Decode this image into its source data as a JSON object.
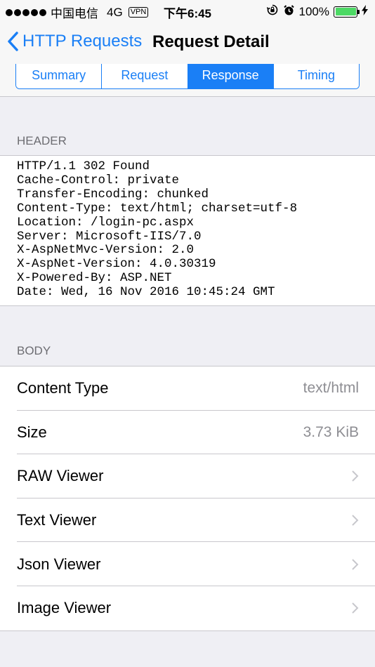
{
  "status_bar": {
    "carrier": "中国电信",
    "network": "4G",
    "vpn": "VPN",
    "time": "下午6:45",
    "battery": "100%",
    "battery_level": 1.0
  },
  "nav": {
    "back_label": "HTTP Requests",
    "title": "Request Detail"
  },
  "tabs": [
    {
      "label": "Summary",
      "active": false
    },
    {
      "label": "Request",
      "active": false
    },
    {
      "label": "Response",
      "active": true
    },
    {
      "label": "Timing",
      "active": false
    }
  ],
  "header_section": {
    "title": "HEADER",
    "lines": [
      "HTTP/1.1 302 Found",
      "Cache-Control: private",
      "Transfer-Encoding: chunked",
      "Content-Type: text/html; charset=utf-8",
      "Location: /login-pc.aspx",
      "Server: Microsoft-IIS/7.0",
      "X-AspNetMvc-Version: 2.0",
      "X-AspNet-Version: 4.0.30319",
      "X-Powered-By: ASP.NET",
      "Date: Wed, 16 Nov 2016 10:45:24 GMT"
    ]
  },
  "body_section": {
    "title": "BODY",
    "rows": [
      {
        "label": "Content Type",
        "value": "text/html"
      },
      {
        "label": "Size",
        "value": "3.73 KiB"
      },
      {
        "label": "RAW Viewer"
      },
      {
        "label": "Text Viewer"
      },
      {
        "label": "Json Viewer"
      },
      {
        "label": "Image Viewer"
      }
    ]
  }
}
